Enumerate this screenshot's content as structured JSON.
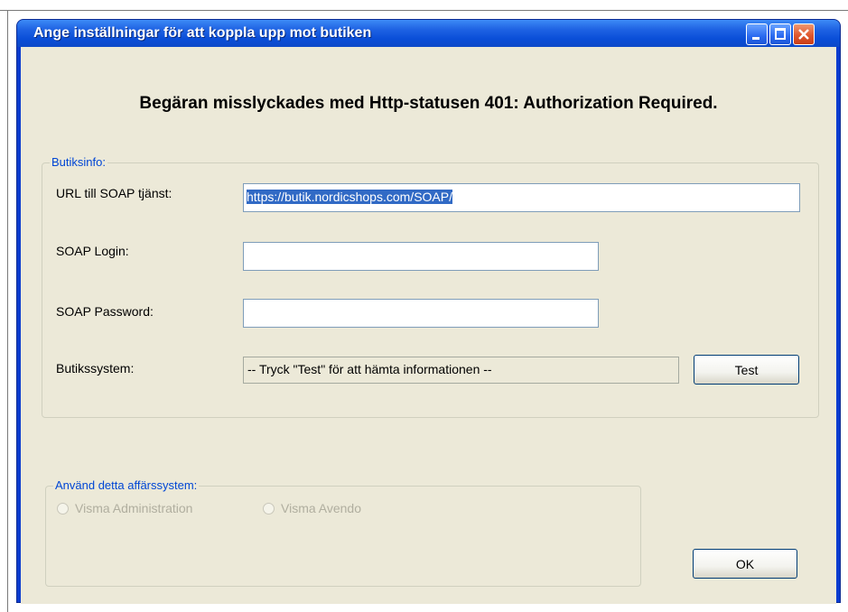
{
  "window": {
    "title": "Ange inställningar för att koppla upp mot butiken"
  },
  "status_message": "Begäran misslyckades med Http-statusen 401: Authorization Required.",
  "shop_info": {
    "legend": "Butiksinfo:",
    "url_label": "URL till SOAP tjänst:",
    "url_value": "https://butik.nordicshops.com/SOAP/",
    "login_label": "SOAP Login:",
    "login_value": "",
    "password_label": "SOAP Password:",
    "password_value": "",
    "system_label": "Butikssystem:",
    "system_value": "-- Tryck \"Test\" för att hämta informationen --",
    "test_button": "Test"
  },
  "business_system": {
    "legend": "Använd detta affärssystem:",
    "options": [
      "Visma Administration",
      "Visma Avendo"
    ]
  },
  "ok_button": "OK",
  "icons": {
    "minimize": "minimize-icon",
    "maximize": "maximize-icon",
    "close": "close-icon"
  }
}
